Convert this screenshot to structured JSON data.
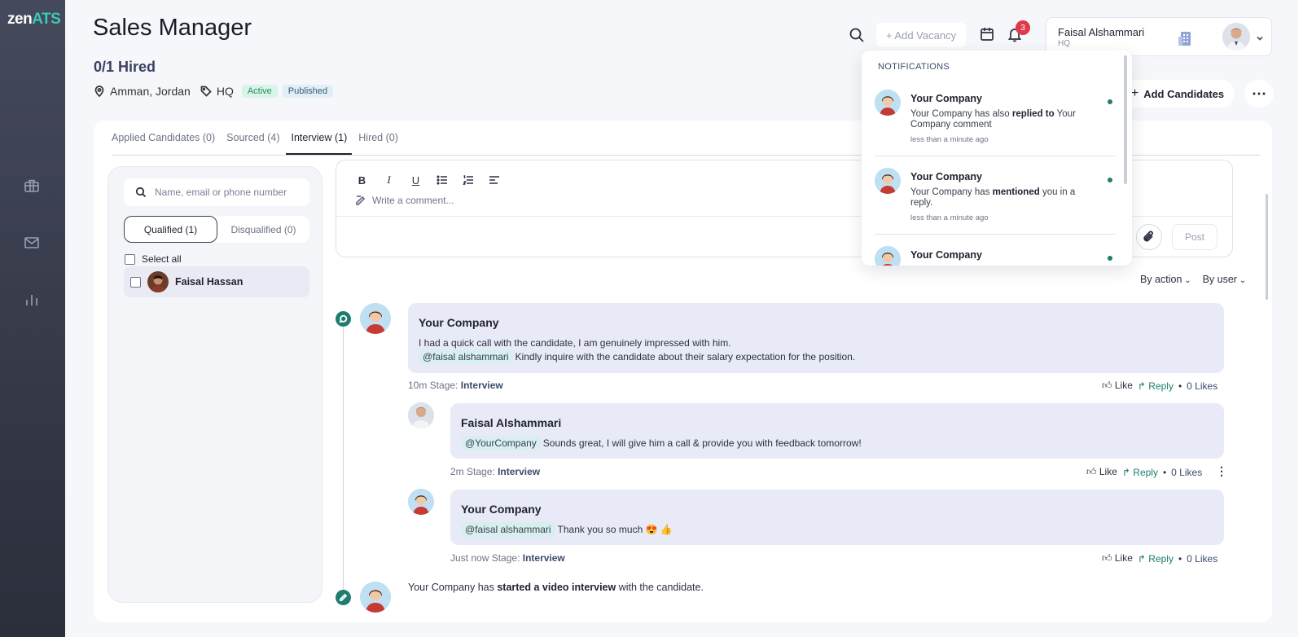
{
  "app": {
    "logo_part1": "zen",
    "logo_part2": "ATS",
    "colors": {
      "sidebar": "#3a3e4e",
      "accent": "#3ec7b5",
      "timeline_node": "#1f7d70",
      "badge_red": "#e0394b"
    }
  },
  "sidebar": {
    "items": [
      {
        "icon": "briefcase-icon"
      },
      {
        "icon": "mail-icon"
      },
      {
        "icon": "bar-chart-icon"
      }
    ]
  },
  "header": {
    "title": "Sales Manager",
    "hired": "0/1 Hired",
    "location": "Amman, Jordan",
    "tag": "HQ",
    "status_active": "Active",
    "status_published": "Published",
    "add_vacancy": "+ Add Vacancy",
    "notification_count": "3",
    "add_candidates": "Add Candidates"
  },
  "user": {
    "name": "Faisal Alshammari",
    "org": "HQ"
  },
  "tabs": [
    {
      "label": "Applied Candidates (0)",
      "active": false
    },
    {
      "label": "Sourced (4)",
      "active": false
    },
    {
      "label": "Interview (1)",
      "active": true
    },
    {
      "label": "Hired (0)",
      "active": false
    }
  ],
  "candidates": {
    "search_placeholder": "Name, email or phone number",
    "qualified": "Qualified (1)",
    "disqualified": "Disqualified (0)",
    "select_all": "Select all",
    "items": [
      {
        "name": "Faisal Hassan"
      }
    ]
  },
  "editor": {
    "placeholder": "Write a comment...",
    "post": "Post",
    "toolbar": [
      "B",
      "I",
      "U"
    ]
  },
  "filters": {
    "by_action": "By action",
    "by_user": "By user"
  },
  "feed": {
    "comments": [
      {
        "author": "Your Company",
        "line1": "I had a quick call with the candidate, I am genuinely impressed with him.",
        "mention": "@faisal alshammari",
        "line2": "Kindly inquire with the candidate about their salary expectation for the position.",
        "time": "10m",
        "stage_label": "Stage:",
        "stage": "Interview",
        "like": "Like",
        "reply": "Reply",
        "likes": "0 Likes"
      },
      {
        "author": "Faisal Alshammari",
        "mention": "@YourCompany",
        "line1": "Sounds great, I will give him a call & provide you with feedback tomorrow!",
        "time": "2m",
        "stage_label": "Stage:",
        "stage": "Interview",
        "like": "Like",
        "reply": "Reply",
        "likes": "0 Likes"
      },
      {
        "author": "Your Company",
        "mention": "@faisal alshammari",
        "line1": "Thank you so much 😍 👍",
        "time": "Just now",
        "stage_label": "Stage:",
        "stage": "Interview",
        "like": "Like",
        "reply": "Reply",
        "likes": "0 Likes"
      }
    ],
    "activity": {
      "actor": "Your Company has",
      "action": "started a video interview",
      "rest": "with the candidate."
    }
  },
  "notifications": {
    "heading": "NOTIFICATIONS",
    "items": [
      {
        "title": "Your Company",
        "pre": "Your Company has also",
        "bold": "replied to",
        "post": "Your Company comment",
        "time": "less than a minute ago"
      },
      {
        "title": "Your Company",
        "pre": "Your Company has",
        "bold": "mentioned",
        "post": "you in a reply.",
        "time": "less than a minute ago"
      },
      {
        "title": "Your Company"
      }
    ]
  }
}
